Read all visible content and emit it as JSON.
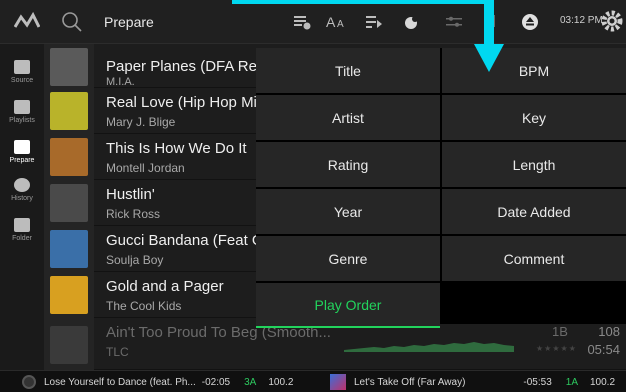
{
  "header": {
    "view_title": "Prepare",
    "clock": "03:12 PM"
  },
  "toolbar_icons": [
    "clear-icon",
    "font-size-icon",
    "playlist-play-icon",
    "shape-icon",
    "sort-icon",
    "download-icon",
    "eject-icon",
    "gear-icon"
  ],
  "sidebar": {
    "items": [
      {
        "label": "Source",
        "icon": "source-icon"
      },
      {
        "label": "Playlists",
        "icon": "playlists-icon"
      },
      {
        "label": "Prepare",
        "icon": "prepare-icon",
        "active": true
      },
      {
        "label": "History",
        "icon": "history-icon"
      },
      {
        "label": "Folder",
        "icon": "folder-icon"
      }
    ]
  },
  "tracks": [
    {
      "title": "Paper Planes (DFA Remix)",
      "artist": "M.I.A.",
      "art_color": "#5a5a5a"
    },
    {
      "title": "Real Love (Hip Hop Mix)",
      "artist": "Mary J. Blige",
      "art_color": "#b9b32a"
    },
    {
      "title": "This Is How We Do It",
      "artist": "Montell Jordan",
      "art_color": "#a86a2a"
    },
    {
      "title": "Hustlin'",
      "artist": "Rick Ross",
      "art_color": "#4a4a4a"
    },
    {
      "title": "Gucci Bandana (Feat Gucci Mane)",
      "artist": "Soulja Boy",
      "art_color": "#3a6fa8"
    },
    {
      "title": "Gold and a Pager",
      "artist": "The Cool Kids",
      "art_color": "#d8a020"
    },
    {
      "title": "Ain't Too Proud To Beg (Smooth...",
      "artist": "TLC",
      "art_color": "#3a3a3a",
      "key": "1B",
      "bpm": "108",
      "length": "05:54",
      "stars": "★★★★★",
      "dim": true
    }
  ],
  "sort_menu": {
    "options": [
      {
        "label": "Title"
      },
      {
        "label": "BPM"
      },
      {
        "label": "Artist"
      },
      {
        "label": "Key"
      },
      {
        "label": "Rating"
      },
      {
        "label": "Length"
      },
      {
        "label": "Year"
      },
      {
        "label": "Date Added"
      },
      {
        "label": "Genre"
      },
      {
        "label": "Comment"
      },
      {
        "label": "Play Order",
        "active": true
      }
    ]
  },
  "decks": {
    "left": {
      "title": "Lose Yourself to Dance (feat. Ph...",
      "remaining": "-02:05",
      "key": "3A",
      "bpm": "100.2"
    },
    "right": {
      "title": "Let's Take Off (Far Away)",
      "remaining": "-05:53",
      "key": "1A",
      "bpm": "100.2"
    }
  },
  "colors": {
    "accent_green": "#22d35c",
    "annotation_cyan": "#00d8f0"
  }
}
